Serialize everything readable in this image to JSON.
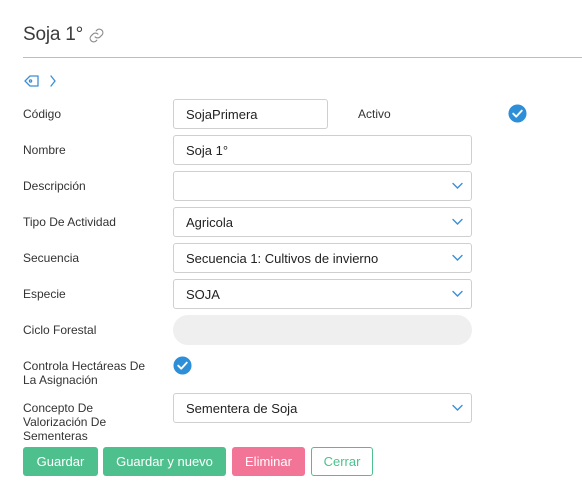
{
  "header": {
    "title": "Soja 1°"
  },
  "form": {
    "codigo_label": "Código",
    "codigo_value": "SojaPrimera",
    "activo_label": "Activo",
    "nombre_label": "Nombre",
    "nombre_value": "Soja 1°",
    "descripcion_label": "Descripción",
    "descripcion_value": "",
    "tipo_label": "Tipo De Actividad",
    "tipo_value": "Agricola",
    "secuencia_label": "Secuencia",
    "secuencia_value": "Secuencia 1: Cultivos de invierno",
    "especie_label": "Especie",
    "especie_value": "SOJA",
    "ciclo_label": "Ciclo Forestal",
    "ciclo_value": "",
    "controla_label_1": "Controla Hectáreas De",
    "controla_label_2": "La Asignación",
    "concepto_label_1": "Concepto De",
    "concepto_label_2": "Valorización De",
    "concepto_label_3": "Sementeras",
    "concepto_value": "Sementera de Soja"
  },
  "state": {
    "activo": true,
    "controla_hectareas": true
  },
  "buttons": {
    "guardar": "Guardar",
    "guardar_nuevo": "Guardar y nuevo",
    "eliminar": "Eliminar",
    "cerrar": "Cerrar"
  },
  "colors": {
    "primary_green": "#4ec08d",
    "danger_pink": "#f27497",
    "check_blue": "#2d8fd8",
    "tag_blue": "#3a8fd8"
  },
  "icons": {
    "title_link": "link-icon",
    "tag": "tag-icon",
    "expand": "chevron-right-icon",
    "dropdown": "chevron-down-icon",
    "checked": "check-circle-icon"
  }
}
